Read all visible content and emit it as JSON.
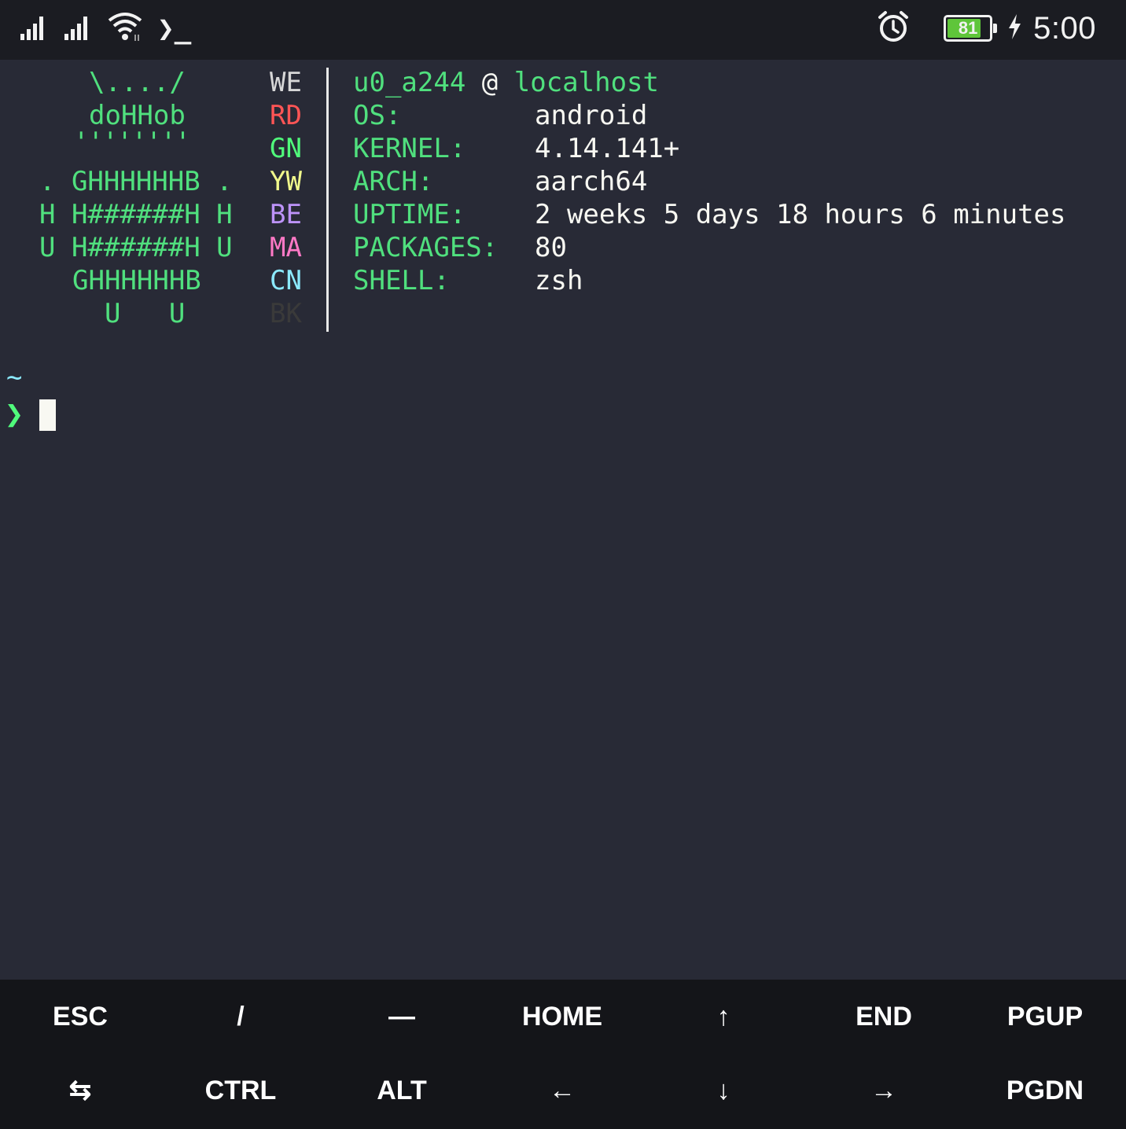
{
  "status_bar": {
    "time": "5:00",
    "battery_level": "81",
    "battery_fraction": 0.81,
    "charging": true,
    "icons": [
      "signal-sim1-icon",
      "signal-sim2-icon",
      "wifi-icon",
      "terminal-notification-icon",
      "alarm-icon",
      "battery-icon",
      "charging-bolt-icon"
    ],
    "terminal_glyph": "❯_"
  },
  "terminal": {
    "logo_lines": [
      "\\..../",
      "doHHob",
      "''''''''",
      ". GHHHHHHB .",
      "H H######H H",
      "U H######H U",
      "GHHHHHHB",
      "U   U"
    ],
    "palette": [
      {
        "label": "WE",
        "color": "#d7d7d7"
      },
      {
        "label": "RD",
        "color": "#ff5555"
      },
      {
        "label": "GN",
        "color": "#50fa7b"
      },
      {
        "label": "YW",
        "color": "#f1fa8c"
      },
      {
        "label": "BE",
        "color": "#bd93f9"
      },
      {
        "label": "MA",
        "color": "#ff79c6"
      },
      {
        "label": "CN",
        "color": "#8be9fd"
      },
      {
        "label": "BK",
        "color": "#3a3a3a"
      }
    ],
    "header": {
      "user": "u0_a244",
      "at": "@",
      "host": "localhost"
    },
    "info": [
      {
        "key": "OS:",
        "value": "android"
      },
      {
        "key": "KERNEL:",
        "value": "4.14.141+"
      },
      {
        "key": "ARCH:",
        "value": "aarch64"
      },
      {
        "key": "UPTIME:",
        "value": "2 weeks 5 days 18 hours 6 minutes"
      },
      {
        "key": "PACKAGES:",
        "value": "80"
      },
      {
        "key": "SHELL:",
        "value": "zsh"
      }
    ],
    "cwd": "~",
    "prompt": "❯"
  },
  "extra_keys": {
    "row1": [
      "ESC",
      "/",
      "—",
      "HOME",
      "↑",
      "END",
      "PGUP"
    ],
    "row2": [
      "⇆",
      "CTRL",
      "ALT",
      "←",
      "↓",
      "→",
      "PGDN"
    ]
  },
  "colors": {
    "background": "#282a36",
    "status_bar": "#1b1c22",
    "extra_keys_bg": "#141519",
    "accent_green": "#50e07e",
    "battery_green": "#5fc53a"
  }
}
